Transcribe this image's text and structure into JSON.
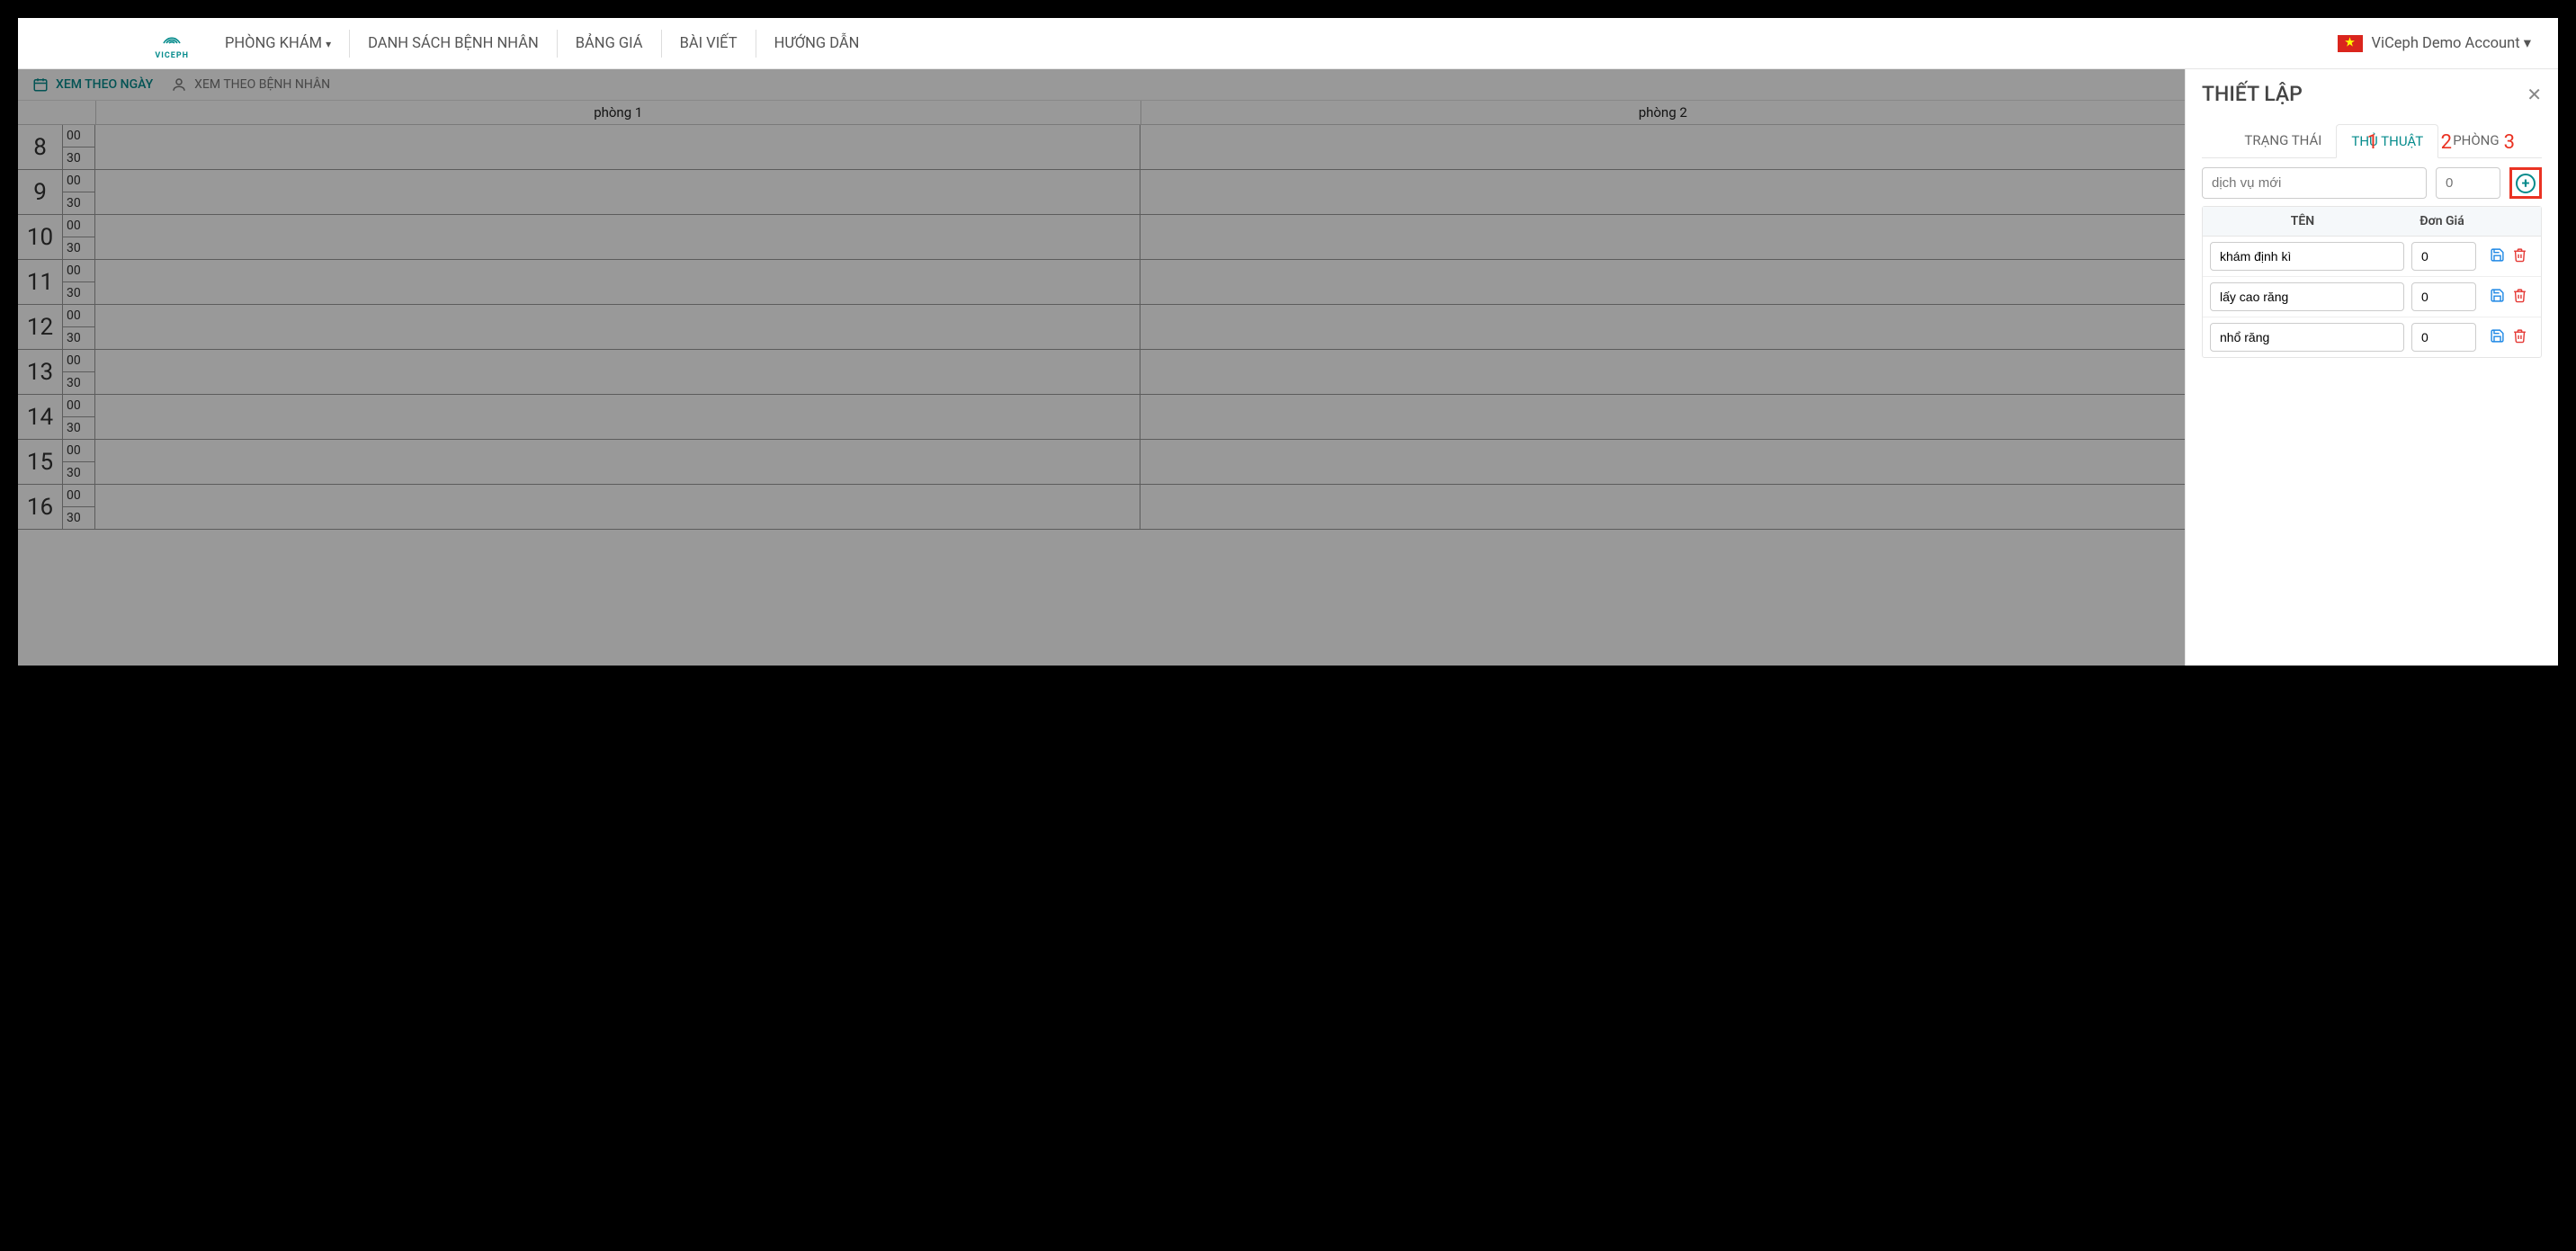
{
  "nav": {
    "items": [
      "PHÒNG KHÁM",
      "DANH SÁCH BỆNH NHÂN",
      "BẢNG GIÁ",
      "BÀI VIẾT",
      "HƯỚNG DẪN"
    ],
    "logo_text": "VICEPH",
    "account": "ViCeph Demo Account"
  },
  "calendar": {
    "view_day": "XEM THEO NGÀY",
    "view_patient": "XEM THEO BỆNH NHÂN",
    "rooms": [
      "phòng 1",
      "phòng 2"
    ],
    "hours": [
      8,
      9,
      10,
      11,
      12,
      13,
      14,
      15,
      16
    ],
    "minutes": [
      "00",
      "30"
    ]
  },
  "panel": {
    "title": "THIẾT LẬP",
    "tabs": [
      "TRẠNG THÁI",
      "THỦ THUẬT",
      "PHÒNG"
    ],
    "active_tab": 1,
    "new_service_placeholder": "dịch vụ mới",
    "new_price_placeholder": "0",
    "col_name": "TÊN",
    "col_price": "Đơn Giá",
    "services": [
      {
        "name": "khám định kì",
        "price": "0"
      },
      {
        "name": "lấy cao răng",
        "price": "0"
      },
      {
        "name": "nhổ răng",
        "price": "0"
      }
    ],
    "annotations": [
      "1",
      "2",
      "3"
    ]
  }
}
